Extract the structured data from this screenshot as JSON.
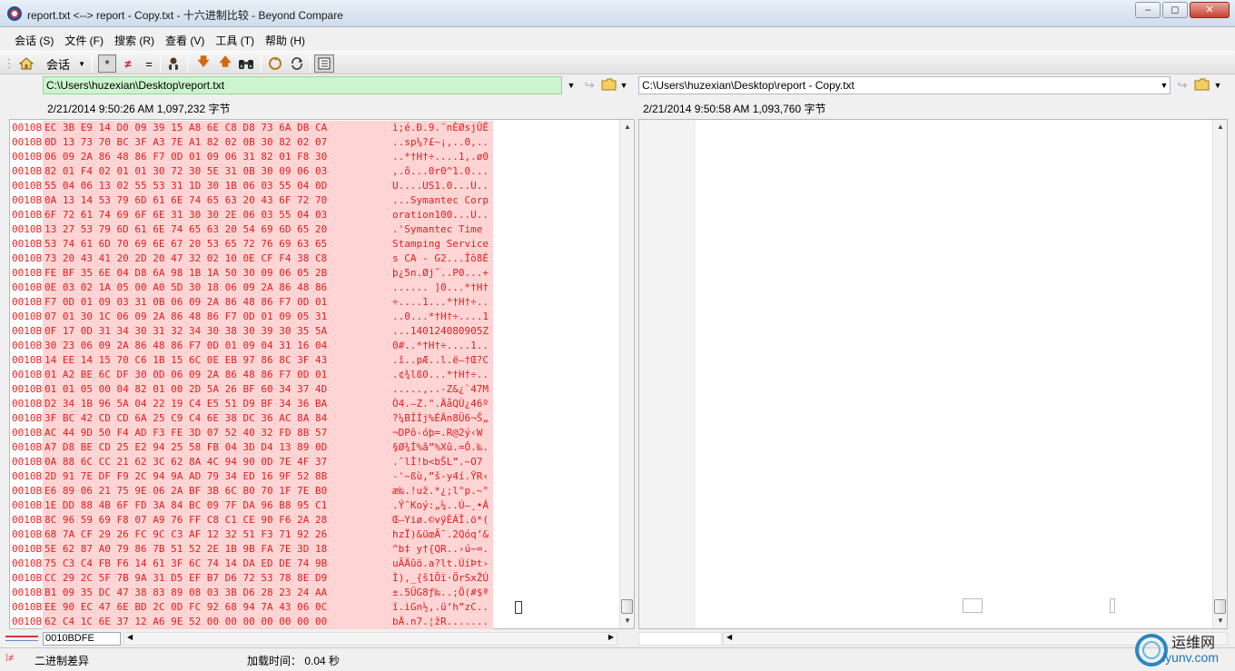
{
  "window": {
    "title": "report.txt <--> report - Copy.txt - 十六进制比较 - Beyond Compare"
  },
  "menu": {
    "items": [
      "会话 (S)",
      "文件 (F)",
      "搜索 (R)",
      "查看 (V)",
      "工具 (T)",
      "帮助 (H)"
    ]
  },
  "toolbar": {
    "session_label": "会话",
    "all_label": "*",
    "diff_label": "≠",
    "same_label": "="
  },
  "left": {
    "path": "C:\\Users\\huzexian\\Desktop\\report.txt",
    "info": "2/21/2014 9:50:26 AM    1,097,232 字节",
    "offset_field": "0010BDFE"
  },
  "right": {
    "path": "C:\\Users\\huzexian\\Desktop\\report - Copy.txt",
    "info": "2/21/2014 9:50:58 AM    1,093,760 字节"
  },
  "hex_rows": [
    {
      "off": "0010BBE0",
      "hex": "EC 3B E9 14 D0 09 39 15 A8 6E C8 D8 73 6A DB CA",
      "ascii": "ì;é.Ð.9.¨nÈØsjÛÊ"
    },
    {
      "off": "0010BBF0",
      "hex": "0D 13 73 70 BC 3F A3 7E A1 82 02 0B 30 82 02 07",
      "ascii": "..sp¼?£~¡,..0,.."
    },
    {
      "off": "0010BC00",
      "hex": "06 09 2A 86 48 86 F7 0D 01 09 06 31 82 01 F8 30",
      "ascii": "..*†H†÷....1,.ø0"
    },
    {
      "off": "0010BC10",
      "hex": "82 01 F4 02 01 01 30 72 30 5E 31 0B 30 09 06 03",
      "ascii": ",.ô...0r0^1.0..."
    },
    {
      "off": "0010BC20",
      "hex": "55 04 06 13 02 55 53 31 1D 30 1B 06 03 55 04 0D",
      "ascii": "U....US1.0...U.."
    },
    {
      "off": "0010BC30",
      "hex": "0A 13 14 53 79 6D 61 6E 74 65 63 20 43 6F 72 70",
      "ascii": "...Symantec Corp"
    },
    {
      "off": "0010BC40",
      "hex": "6F 72 61 74 69 6F 6E 31 30 30 2E 06 03 55 04 03",
      "ascii": "oration100...U.."
    },
    {
      "off": "0010BC50",
      "hex": "13 27 53 79 6D 61 6E 74 65 63 20 54 69 6D 65 20",
      "ascii": ".'Symantec Time "
    },
    {
      "off": "0010BC60",
      "hex": "53 74 61 6D 70 69 6E 67 20 53 65 72 76 69 63 65",
      "ascii": "Stamping Service"
    },
    {
      "off": "0010BC70",
      "hex": "73 20 43 41 20 2D 20 47 32 02 10 0E CF F4 38 C8",
      "ascii": "s CA - G2...Ïô8È"
    },
    {
      "off": "0010BC80",
      "hex": "FE BF 35 6E 04 D8 6A 98 1B 1A 50 30 09 06 05 2B",
      "ascii": "þ¿5n.Øj˜..P0...+"
    },
    {
      "off": "0010BC90",
      "hex": "0E 03 02 1A 05 00 A0 5D 30 18 06 09 2A 86 48 86",
      "ascii": "...... ]0...*†H†"
    },
    {
      "off": "0010BCA0",
      "hex": "F7 0D 01 09 03 31 0B 06 09 2A 86 48 86 F7 0D 01",
      "ascii": "÷....1...*†H†÷.."
    },
    {
      "off": "0010BCB0",
      "hex": "07 01 30 1C 06 09 2A 86 48 86 F7 0D 01 09 05 31",
      "ascii": "..0...*†H†÷....1"
    },
    {
      "off": "0010BCC0",
      "hex": "0F 17 0D 31 34 30 31 32 34 30 38 30 39 30 35 5A",
      "ascii": "...140124080905Z"
    },
    {
      "off": "0010BCD0",
      "hex": "30 23 06 09 2A 86 48 86 F7 0D 01 09 04 31 16 04",
      "ascii": "0#..*†H†÷....1.."
    },
    {
      "off": "0010BCE0",
      "hex": "14 EE 14 15 70 C6 1B 15 6C 0E EB 97 86 8C 3F 43",
      "ascii": ".î..pÆ..l.ë—†Œ?C"
    },
    {
      "off": "0010BCF0",
      "hex": "01 A2 BE 6C DF 30 0D 06 09 2A 86 48 86 F7 0D 01",
      "ascii": ".¢¾lß0...*†H†÷.."
    },
    {
      "off": "0010BD00",
      "hex": "01 01 05 00 04 82 01 00 2D 5A 26 BF 60 34 37 4D",
      "ascii": ".....,..-Z&¿`47M"
    },
    {
      "off": "0010BD10",
      "hex": "D2 34 1B 96 5A 04 22 19 C4 E5 51 D9 BF 34 36 BA",
      "ascii": "Ò4.–Z.\".ÄåQÙ¿46º"
    },
    {
      "off": "0010BD20",
      "hex": "3F BC 42 CD CD 6A 25 C9 C4 6E 38 DC 36 AC 8A 84",
      "ascii": "?¼BÍÍj%ÉÄn8Ü6¬Š„"
    },
    {
      "off": "0010BD30",
      "hex": "AC 44 9D 50 F4 AD F3 FE 3D 07 52 40 32 FD 8B 57",
      "ascii": "¬DPô-óþ=.R@2ý‹W"
    },
    {
      "off": "0010BD40",
      "hex": "A7 D8 BE CD 25 E2 94 25 58 FB 04 3D D4 13 89 0D",
      "ascii": "§Ø¾Í%â”%Xû.=Ô.‰."
    },
    {
      "off": "0010BD50",
      "hex": "0A 88 6C CC 21 62 3C 62 8A 4C 94 90 0D 7E 4F 37",
      "ascii": ".ˆlÌ!b<bŠL”.~O7"
    },
    {
      "off": "0010BD60",
      "hex": "2D 91 7E DF F9 2C 94 9A AD 79 34 ED 16 9F 52 8B",
      "ascii": "-'~ßù,”š-y4í.ŸR‹"
    },
    {
      "off": "0010BD70",
      "hex": "E6 89 06 21 75 9E 06 2A BF 3B 6C B0 70 1F 7E B0",
      "ascii": "æ‰.!už.*¿;l°p.~°"
    },
    {
      "off": "0010BD80",
      "hex": "1E DD 88 4B 6F FD 3A 84 BC 09 7F DA 96 B8 95 C1",
      "ascii": ".ÝˆKoý:„¼..Ú–¸•Á"
    },
    {
      "off": "0010BD90",
      "hex": "8C 96 59 69 F8 07 A9 76 FF C8 C1 CE 90 F6 2A 28",
      "ascii": "Œ–Yiø.©vÿÈÁÎ.ö*("
    },
    {
      "off": "0010BDA0",
      "hex": "68 7A CF 29 26 FC 9C C3 AF 12 32 51 F3 71 92 26",
      "ascii": "hzÏ)&üœÃ¯.2Qóq’&"
    },
    {
      "off": "0010BDB0",
      "hex": "5E 62 87 A0 79 86 7B 51 52 2E 1B 9B FA 7E 3D 18",
      "ascii": "^b‡ y†{QR..›ú~=."
    },
    {
      "off": "0010BDC0",
      "hex": "75 C3 C4 FB F6 14 61 3F 6C 74 14 DA ED DE 74 9B",
      "ascii": "uÃÄûö.a?lt.ÚíÞt›"
    },
    {
      "off": "0010BDD0",
      "hex": "CC 29 2C 5F 7B 9A 31 D5 EF B7 D6 72 53 78 8E D9",
      "ascii": "Ì),_{š1Õï·ÖrSxŽÙ"
    },
    {
      "off": "0010BDE0",
      "hex": "B1 09 35 DC 47 38 83 89 08 03 3B D6 28 23 24 AA",
      "ascii": "±.5ÜG8ƒ‰..;Ö(#$ª"
    },
    {
      "off": "0010BDF0",
      "hex": "EE 90 EC 47 6E BD 2C 0D FC 92 68 94 7A 43 06 0C",
      "ascii": "î.ìGn½,.ü’h”zC.."
    },
    {
      "off": "0010BE00",
      "hex": "62 C4 1C 6E 37 12 A6 9E 52 00 00 00 00 00 00 00",
      "ascii": "bÄ.n7.¦žR......."
    }
  ],
  "status": {
    "mode_label": "二进制差异",
    "load_time": "加载时间： 0.04 秒"
  },
  "watermark": {
    "cn": "运维网",
    "url": "iyunv.com"
  },
  "colors": {
    "diff_text": "#e02020",
    "diff_bg": "#ffd4d4",
    "left_path_bg": "#cdf5cd"
  }
}
